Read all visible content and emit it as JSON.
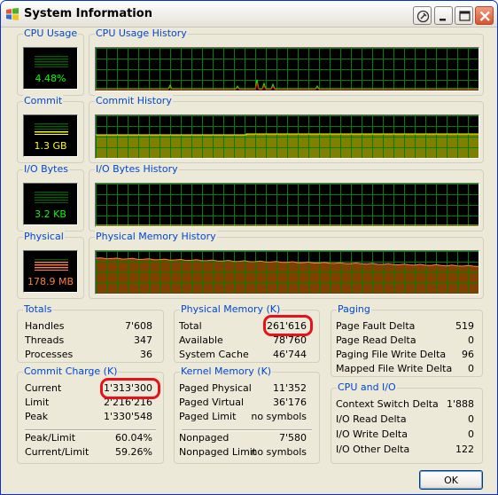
{
  "window": {
    "title": "System Information"
  },
  "colors": {
    "graph_grid": "#008000",
    "cpu_meter": "#00ff00",
    "commit_meter": "#ffff00",
    "physical_meter": "#ff8040",
    "commit_fill": "#808000",
    "physical_fill": "#804000",
    "label_blue": "#0046d5",
    "highlight_red": "#e8101a"
  },
  "graphs": {
    "cpu": {
      "label": "CPU Usage",
      "value": "4.48%",
      "history_label": "CPU Usage History",
      "level": 0.0448
    },
    "commit": {
      "label": "Commit",
      "value": "1.3 GB",
      "history_label": "Commit History",
      "level": 0.43
    },
    "io": {
      "label": "I/O Bytes",
      "value": "3.2  KB",
      "history_label": "I/O Bytes History",
      "level": 0.0
    },
    "physical": {
      "label": "Physical",
      "value": "178.9 MB",
      "history_label": "Physical Memory History",
      "level": 0.68
    }
  },
  "totals": {
    "label": "Totals",
    "rows": [
      {
        "label": "Handles",
        "value": "7'608"
      },
      {
        "label": "Threads",
        "value": "347"
      },
      {
        "label": "Processes",
        "value": "36"
      }
    ]
  },
  "commit_charge": {
    "label": "Commit Charge (K)",
    "rows": [
      {
        "label": "Current",
        "value": "1'313'300"
      },
      {
        "label": "Limit",
        "value": "2'216'216"
      },
      {
        "label": "Peak",
        "value": "1'330'548"
      }
    ],
    "ratios": [
      {
        "label": "Peak/Limit",
        "value": "60.04%"
      },
      {
        "label": "Current/Limit",
        "value": "59.26%"
      }
    ]
  },
  "physical_memory": {
    "label": "Physical Memory (K)",
    "rows": [
      {
        "label": "Total",
        "value": "261'616"
      },
      {
        "label": "Available",
        "value": "78'760"
      },
      {
        "label": "System Cache",
        "value": "46'744"
      }
    ]
  },
  "kernel_memory": {
    "label": "Kernel Memory (K)",
    "rows": [
      {
        "label": "Paged Physical",
        "value": "11'352"
      },
      {
        "label": "Paged Virtual",
        "value": "36'176"
      },
      {
        "label": "Paged Limit",
        "value": "no symbols"
      }
    ],
    "rows2": [
      {
        "label": "Nonpaged",
        "value": "7'580"
      },
      {
        "label": "Nonpaged Limit",
        "value": "no symbols"
      }
    ]
  },
  "paging": {
    "label": "Paging",
    "rows": [
      {
        "label": "Page Fault Delta",
        "value": "519"
      },
      {
        "label": "Page Read Delta",
        "value": "0"
      },
      {
        "label": "Paging File Write Delta",
        "value": "96"
      },
      {
        "label": "Mapped File Write Delta",
        "value": "0"
      }
    ]
  },
  "cpu_io": {
    "label": "CPU and I/O",
    "rows": [
      {
        "label": "Context Switch Delta",
        "value": "1'888"
      },
      {
        "label": "I/O Read Delta",
        "value": "0"
      },
      {
        "label": "I/O Write Delta",
        "value": "0"
      },
      {
        "label": "I/O Other Delta",
        "value": "122"
      }
    ]
  },
  "buttons": {
    "ok": "OK"
  }
}
